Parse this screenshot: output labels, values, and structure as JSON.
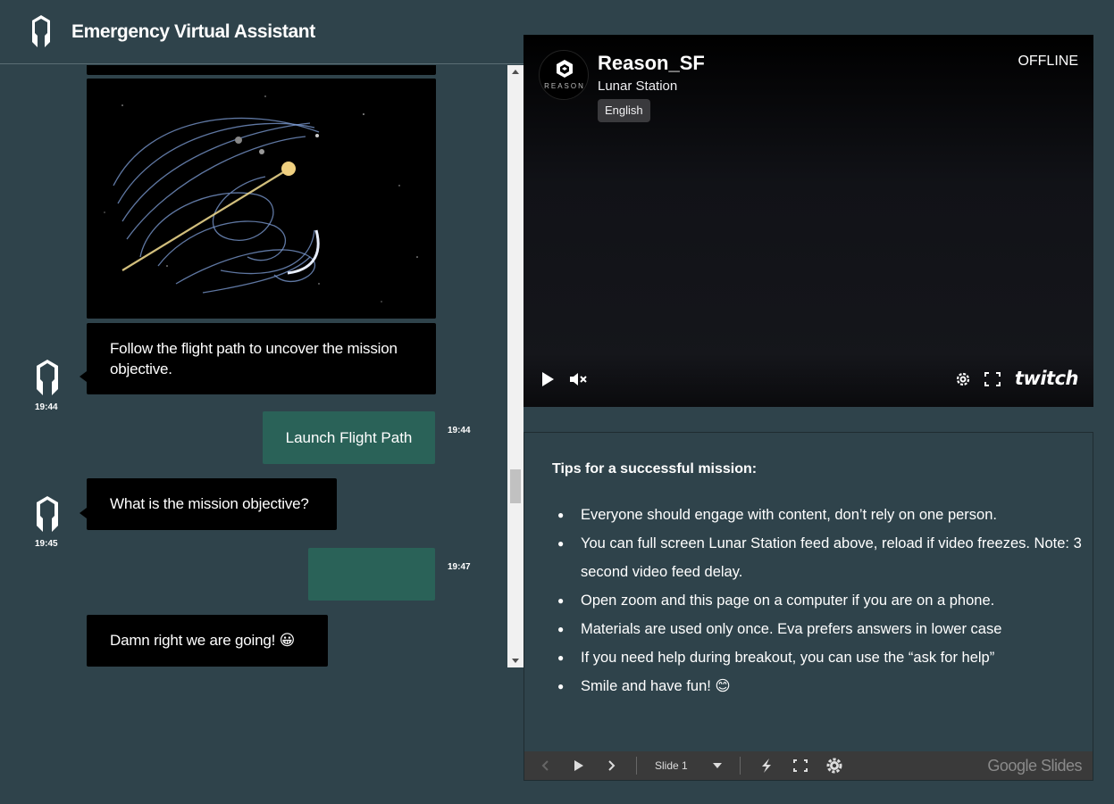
{
  "app": {
    "title": "Emergency Virtual Assistant"
  },
  "chat": {
    "messages": [
      {
        "from": "bot",
        "text": "Follow the flight path to uncover the mission objective.",
        "time": "19:44"
      },
      {
        "from": "user",
        "text": "Launch Flight Path",
        "time": "19:44"
      },
      {
        "from": "bot",
        "text": "What is the mission objective?",
        "time": "19:45"
      },
      {
        "from": "user",
        "text": "",
        "time": "19:47"
      },
      {
        "from": "bot",
        "text": "Damn right we are going! 😀"
      }
    ]
  },
  "player": {
    "channel_name": "Reason_SF",
    "brand_text": "REASON",
    "game": "Lunar Station",
    "language": "English",
    "status": "OFFLINE",
    "logo_text": "twitch",
    "icons": [
      "play-icon",
      "mute-icon",
      "settings-icon",
      "fullscreen-icon"
    ]
  },
  "slides": {
    "title": "Tips for a successful mission:",
    "tips": [
      "Everyone should engage with content, don’t rely on one person.",
      "You can full screen Lunar Station feed above, reload if video freezes. Note: 3 second video feed delay.",
      "Open zoom and this page on a computer if you are on a phone.",
      "Materials are used only once. Eva prefers answers in lower case",
      "If you need help during breakout, you can use the “ask for help”",
      "Smile and have fun! 😊"
    ],
    "toolbar": {
      "slide_label": "Slide 1",
      "brand": "Google Slides"
    }
  },
  "colors": {
    "background": "#2f434b",
    "bot_bubble": "#000000",
    "user_bubble": "#2a6258"
  }
}
